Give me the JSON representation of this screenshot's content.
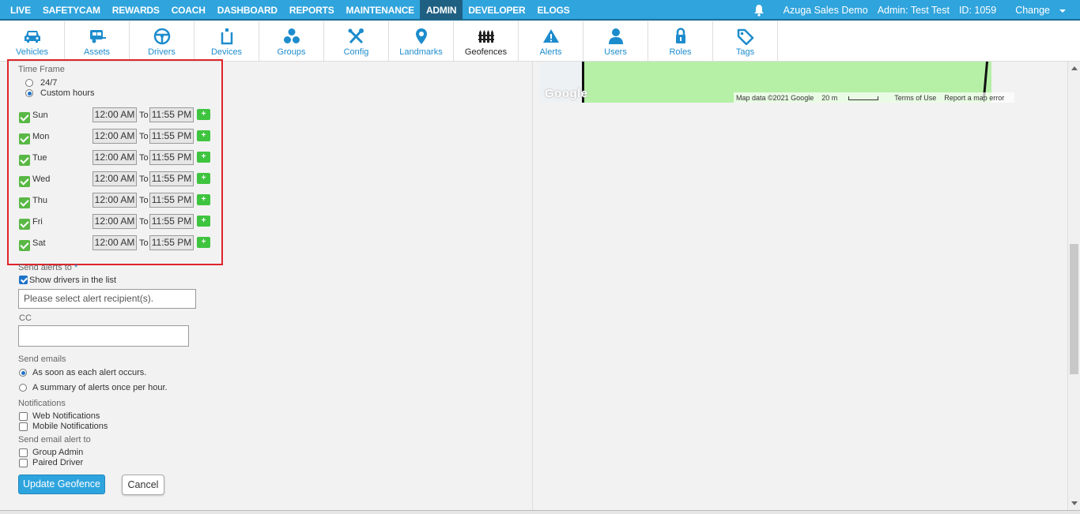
{
  "topnav": {
    "items": [
      {
        "label": "LIVE"
      },
      {
        "label": "SAFETYCAM"
      },
      {
        "label": "REWARDS"
      },
      {
        "label": "COACH"
      },
      {
        "label": "DASHBOARD"
      },
      {
        "label": "REPORTS"
      },
      {
        "label": "MAINTENANCE"
      },
      {
        "label": "ADMIN"
      },
      {
        "label": "DEVELOPER"
      },
      {
        "label": "ELOGS"
      }
    ],
    "active": "ADMIN",
    "account": "Azuga Sales Demo",
    "user": "Admin: Test Test",
    "id": "ID: 1059",
    "change": "Change"
  },
  "toolbar": {
    "items": [
      {
        "label": "Vehicles",
        "icon": "car-icon"
      },
      {
        "label": "Assets",
        "icon": "trailer-icon"
      },
      {
        "label": "Drivers",
        "icon": "steering-wheel-icon"
      },
      {
        "label": "Devices",
        "icon": "device-icon"
      },
      {
        "label": "Groups",
        "icon": "groups-icon"
      },
      {
        "label": "Config",
        "icon": "tools-icon"
      },
      {
        "label": "Landmarks",
        "icon": "map-pin-icon"
      },
      {
        "label": "Geofences",
        "icon": "fence-icon"
      },
      {
        "label": "Alerts",
        "icon": "warning-icon"
      },
      {
        "label": "Users",
        "icon": "user-icon"
      },
      {
        "label": "Roles",
        "icon": "lock-icon"
      },
      {
        "label": "Tags",
        "icon": "tag-icon"
      }
    ],
    "active": "Geofences"
  },
  "map": {
    "logo": "Google",
    "attribution": "Map data ©2021 Google",
    "scale": "20 m",
    "terms": "Terms of Use",
    "report": "Report a map error"
  },
  "timeframe": {
    "title": "Time Frame",
    "option_247": "24/7",
    "option_custom": "Custom hours",
    "selected": "Custom hours",
    "to_label": "To",
    "plus_label": "+",
    "days": [
      {
        "day": "Sun",
        "from": "12:00 AM",
        "to": "11:55 PM",
        "checked": true
      },
      {
        "day": "Mon",
        "from": "12:00 AM",
        "to": "11:55 PM",
        "checked": true
      },
      {
        "day": "Tue",
        "from": "12:00 AM",
        "to": "11:55 PM",
        "checked": true
      },
      {
        "day": "Wed",
        "from": "12:00 AM",
        "to": "11:55 PM",
        "checked": true
      },
      {
        "day": "Thu",
        "from": "12:00 AM",
        "to": "11:55 PM",
        "checked": true
      },
      {
        "day": "Fri",
        "from": "12:00 AM",
        "to": "11:55 PM",
        "checked": true
      },
      {
        "day": "Sat",
        "from": "12:00 AM",
        "to": "11:55 PM",
        "checked": true
      }
    ]
  },
  "alerts": {
    "send_to_label": "Send alerts to",
    "required_mark": "*",
    "show_drivers": "Show drivers in the list",
    "recipients_placeholder": "Please select alert recipient(s).",
    "cc_label": "CC",
    "send_emails_label": "Send emails",
    "email_immediate": "As soon as each alert occurs.",
    "email_summary": "A summary of alerts once per hour.",
    "notifications_label": "Notifications",
    "web_notifications": "Web Notifications",
    "mobile_notifications": "Mobile Notifications",
    "send_email_alert_to_label": "Send email alert to",
    "group_admin": "Group Admin",
    "paired_driver": "Paired Driver"
  },
  "buttons": {
    "update": "Update Geofence",
    "cancel": "Cancel"
  }
}
